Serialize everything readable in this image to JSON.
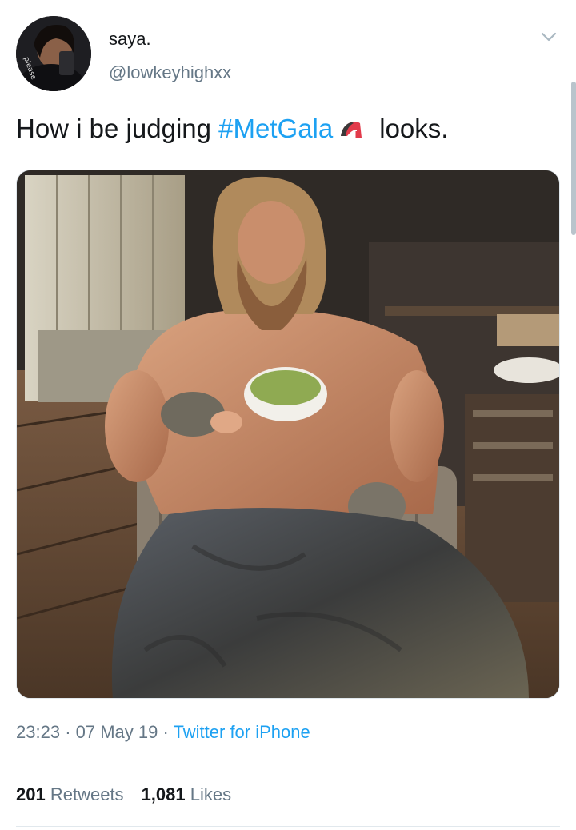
{
  "tweet": {
    "display_name": "saya.",
    "handle": "@lowkeyhighxx",
    "text_before": "How i be judging ",
    "hashtag": "#MetGala",
    "emoji_icon": "high-heel-shoe-icon",
    "text_after": "looks.",
    "avatar_icon": "profile-photo",
    "media_description_icon": "attached-photo",
    "time": "23:23",
    "date": "07 May 19",
    "separator": "·",
    "source": "Twitter for iPhone",
    "retweets_count": "201",
    "retweets_label": "Retweets",
    "likes_count": "1,081",
    "likes_label": "Likes"
  },
  "colors": {
    "link": "#1da1f2",
    "secondary_text": "#657786",
    "primary_text": "#14171a",
    "divider": "#e1e8ed"
  }
}
